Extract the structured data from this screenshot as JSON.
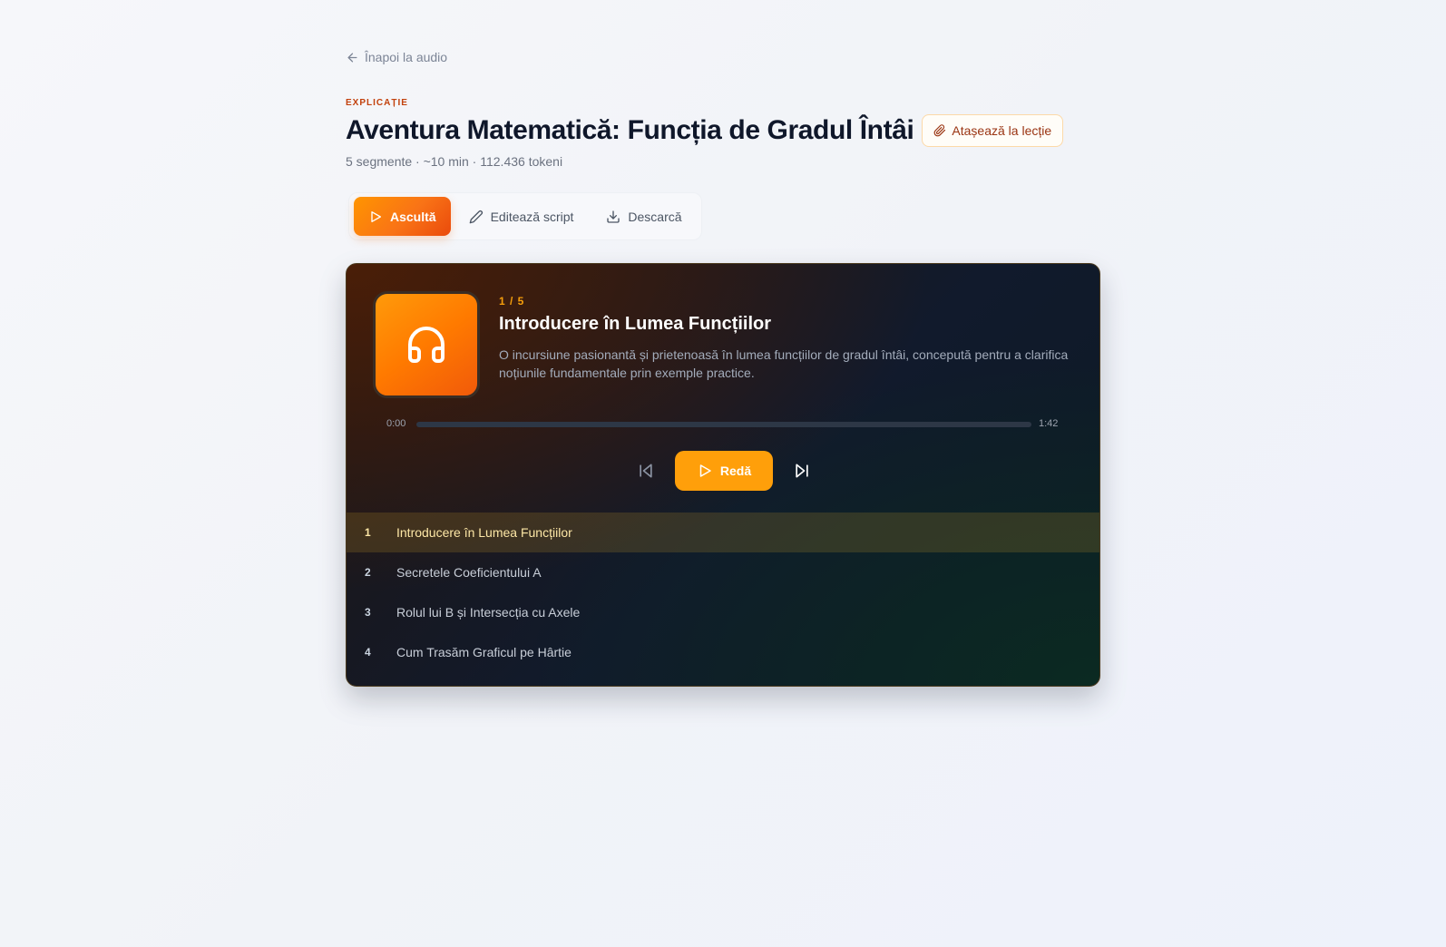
{
  "nav": {
    "back_label": "Înapoi la audio"
  },
  "header": {
    "kicker": "EXPLICAȚIE",
    "title": "Aventura Matematică: Funcția de Gradul Întâi",
    "attach_label": "Atașează la lecție",
    "meta": "5 segmente · ~10 min · 112.436 tokeni"
  },
  "tabs": [
    {
      "label": "Ascultă",
      "icon": "play-icon",
      "active": true
    },
    {
      "label": "Editează script",
      "icon": "pencil-icon",
      "active": false
    },
    {
      "label": "Descarcă",
      "icon": "download-icon",
      "active": false
    }
  ],
  "player": {
    "counter": "1 / 5",
    "segment_title": "Introducere în Lumea Funcțiilor",
    "segment_description": "O incursiune pasionantă și prietenoasă în lumea funcțiilor de gradul întâi, concepută pentru a clarifica noțiunile fundamentale prin exemple practice.",
    "time_current": "0:00",
    "time_total": "1:42",
    "progress_fraction": 0,
    "play_label": "Redă",
    "cover_icon": "headphones-icon"
  },
  "segments": [
    {
      "num": "1",
      "title": "Introducere în Lumea Funcțiilor",
      "active": true
    },
    {
      "num": "2",
      "title": "Secretele Coeficientului A",
      "active": false
    },
    {
      "num": "3",
      "title": "Rolul lui B și Intersecția cu Axele",
      "active": false
    },
    {
      "num": "4",
      "title": "Cum Trasăm Graficul pe Hârtie",
      "active": false
    }
  ],
  "colors": {
    "accent": "#ff9f0a",
    "accent_dark": "#ea4a0c",
    "kicker": "#c2410c",
    "player_bg": "#111a2c"
  }
}
